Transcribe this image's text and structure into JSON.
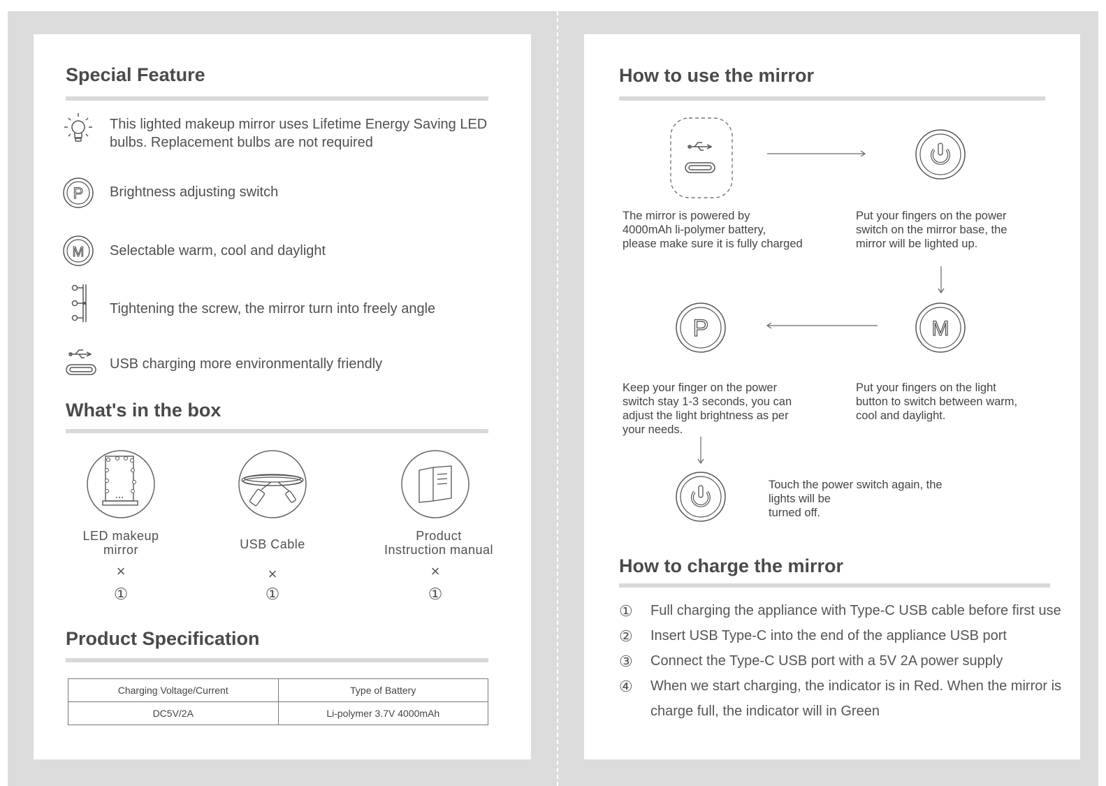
{
  "special_feature": {
    "heading": "Special Feature",
    "items": [
      {
        "icon": "bulb-icon",
        "text_line1": "This lighted makeup mirror uses Lifetime Energy Saving LED",
        "text_line2": "bulbs. Replacement bulbs are not required"
      },
      {
        "icon": "p-button-icon",
        "text": "Brightness adjusting switch"
      },
      {
        "icon": "m-button-icon",
        "text": "Selectable warm, cool and daylight"
      },
      {
        "icon": "screw-hinge-icon",
        "text": "Tightening the screw, the mirror turn into freely angle"
      },
      {
        "icon": "usb-c-icon",
        "text": "USB charging more environmentally friendly"
      }
    ]
  },
  "box": {
    "heading": "What's in the box",
    "items": [
      {
        "icon": "led-mirror-icon",
        "label_line1": "LED makeup",
        "label_line2": "mirror",
        "multiplier": "×",
        "qty": "①"
      },
      {
        "icon": "usb-cable-icon",
        "label_line1": "USB Cable",
        "label_line2": "",
        "multiplier": "×",
        "qty": "①"
      },
      {
        "icon": "manual-book-icon",
        "label_line1": "Product",
        "label_line2": "Instruction manual",
        "multiplier": "×",
        "qty": "①"
      }
    ]
  },
  "spec": {
    "heading": "Product Specification",
    "headers": [
      "Charging Voltage/Current",
      "Type of Battery"
    ],
    "rows": [
      [
        "DC5V/2A",
        "Li-polymer 3.7V 4000mAh"
      ]
    ]
  },
  "usage": {
    "heading": "How to use the mirror",
    "steps": {
      "battery": [
        "The mirror is powered by",
        "4000mAh li-polymer battery,",
        "please make sure it is fully charged"
      ],
      "power_on": [
        "Put your fingers on the power",
        "switch on the mirror base, the",
        "mirror will be lighted up."
      ],
      "brightness": [
        "Keep your finger on the power",
        "switch stay 1-3 seconds, you can",
        "adjust the light brightness as per",
        "your needs."
      ],
      "light_mode": [
        "Put your fingers on the light",
        "button to switch between warm,",
        "cool and daylight."
      ],
      "power_off": [
        "Touch the power switch again, the",
        "lights will be",
        "turned off."
      ]
    }
  },
  "charge": {
    "heading": "How to charge the mirror",
    "items": [
      {
        "num": "①",
        "text": "Full charging the appliance with Type-C USB cable before first use"
      },
      {
        "num": "②",
        "text": "Insert USB Type-C into the end of the appliance USB port"
      },
      {
        "num": "③",
        "text": "Connect the Type-C USB port with a 5V 2A power supply"
      },
      {
        "num": "④",
        "text": "When we start charging, the indicator is in Red. When the mirror is",
        "text2": "charge full, the indicator will in Green"
      }
    ]
  }
}
